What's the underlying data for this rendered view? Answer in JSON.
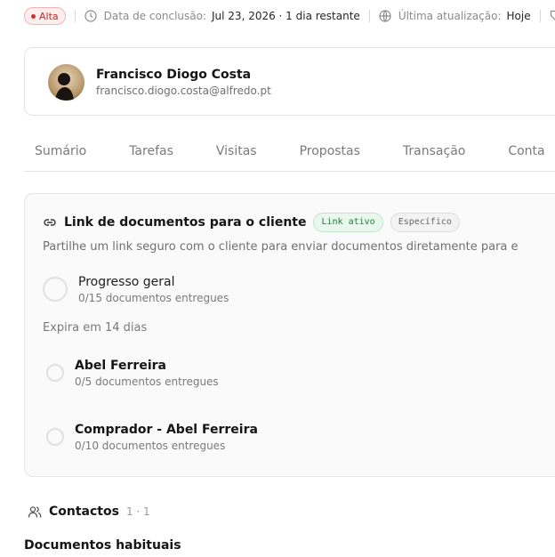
{
  "header": {
    "priority": "Alta",
    "due_label": "Data de conclusão:",
    "due_value": "Jul 23, 2026 · 1 dia restante",
    "updated_label": "Última atualização:",
    "updated_value": "Hoje"
  },
  "contact": {
    "name": "Francisco Diogo Costa",
    "email": "francisco.diogo.costa@alfredo.pt"
  },
  "tabs": [
    "Sumário",
    "Tarefas",
    "Visitas",
    "Propostas",
    "Transação",
    "Conta"
  ],
  "link_card": {
    "title": "Link de documentos para o cliente",
    "status_badge": "Link ativo",
    "type_badge": "Específico",
    "description": "Partilhe um link seguro com o cliente para enviar documentos diretamente para e",
    "progress": {
      "title": "Progresso geral",
      "subtitle": "0/15 documentos entregues",
      "fraction": 0
    },
    "expiry": "Expira em 14 dias",
    "people": [
      {
        "name": "Abel Ferreira",
        "subtitle": "0/5 documentos entregues",
        "fraction": 0
      },
      {
        "name": "Comprador - Abel Ferreira",
        "subtitle": "0/10 documentos entregues",
        "fraction": 0
      }
    ]
  },
  "contacts_section": {
    "title": "Contactos",
    "count": "1 · 1"
  },
  "documents_section": {
    "title": "Documentos habituais"
  },
  "colors": {
    "priority": "#d32f2f",
    "active_badge": "#1f7a3d"
  }
}
